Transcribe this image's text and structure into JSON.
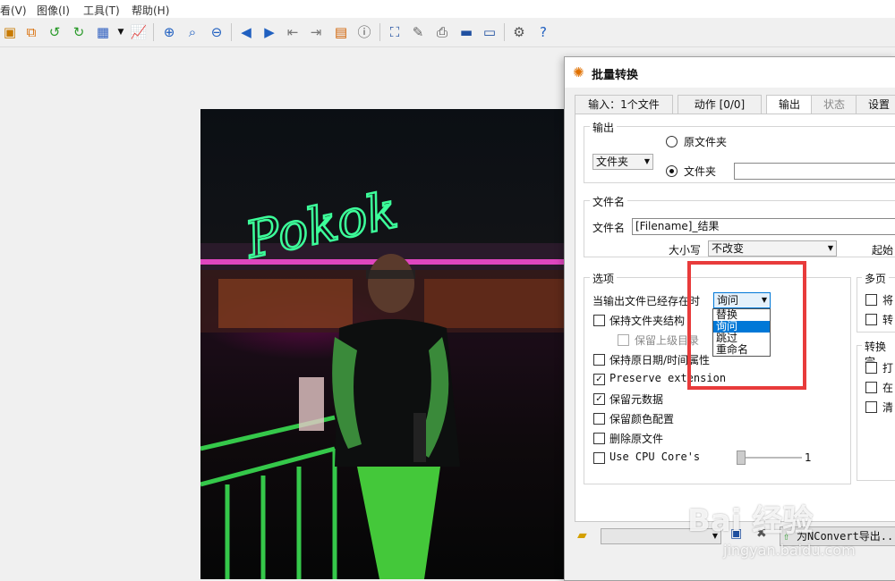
{
  "menu": {
    "view": "看(V)",
    "image": "图像(I)",
    "tools": "工具(T)",
    "help": "帮助(H)"
  },
  "dialog": {
    "title": "批量转换",
    "tabs": [
      "输入：1个文件",
      "动作 [0/0]",
      "输出",
      "状态",
      "设置"
    ],
    "output_group": {
      "label": "输出",
      "folder_type": "文件夹",
      "radio_original": "原文件夹",
      "radio_folder": "文件夹",
      "folder_path": ""
    },
    "filename_group": {
      "label": "文件名",
      "filename_label": "文件名",
      "filename_value": "[Filename]_结果",
      "case_label": "大小写",
      "case_value": "不改变",
      "start_label": "起始"
    },
    "options_group": {
      "label": "选项",
      "exists_label": "当输出文件已经存在时",
      "exists_value": "询问",
      "dropdown_options": [
        "替换",
        "询问",
        "跳过",
        "重命名"
      ],
      "keep_folder": "保持文件夹结构",
      "keep_parent": "保留上级目录",
      "keep_date": "保持原日期/时间属性",
      "preserve_ext": "Preserve extension",
      "keep_meta": "保留元数据",
      "keep_color": "保留颜色配置",
      "delete_orig": "删除原文件",
      "cpu_cores": "Use CPU Core's",
      "cpu_value": "1"
    },
    "multipage_group": {
      "label": "多页",
      "item1": "将",
      "item2": "转"
    },
    "convert_group": {
      "label": "转换完",
      "item1": "打",
      "item2": "在",
      "item3": "清"
    },
    "export_button": "为NConvert导出..."
  },
  "watermark": {
    "main": "Bai 经验",
    "sub": "jingyan.baidu.com"
  },
  "colors": {
    "highlight": "#e83b3b",
    "selected": "#0078d7"
  }
}
